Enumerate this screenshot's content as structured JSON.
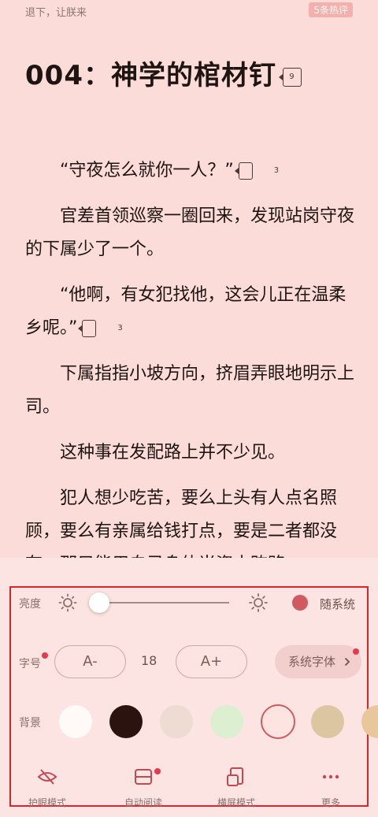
{
  "top": {
    "title": "退下，让朕来",
    "hot_comments": "5条热评"
  },
  "chapter": {
    "title": "004：神学的棺材钉",
    "comment_count": "9"
  },
  "paragraphs": [
    {
      "text": "“守夜怎么就你一人？”",
      "comments": "3"
    },
    {
      "text": "官差首领巡察一圈回来，发现站岗守夜的下属少了一个。"
    },
    {
      "text": "“他啊，有女犯找他，这会儿正在温柔乡呢。”",
      "comments": "3"
    },
    {
      "text": "下属指指小坡方向，挤眉弄眼地明示上司。"
    },
    {
      "text": "这种事在发配路上并不少见。"
    },
    {
      "text": "犯人想少吃苦，要么上头有人点名照顾，要么有亲属给钱打点，要是二者都没有，那只能用自己身体当资本贿赂"
    }
  ],
  "settings": {
    "brightness": {
      "label": "亮度",
      "level": 0.0,
      "system_label": "随系统"
    },
    "font_size": {
      "label": "字号",
      "decrease_label": "A-",
      "increase_label": "A+",
      "value": "18",
      "font_button_label": "系统字体"
    },
    "background": {
      "label": "背景",
      "colors": [
        "#fffaf8",
        "#2b1310",
        "#eedbd2",
        "#dcefd0",
        "#fde4e1",
        "#dcc6a2",
        "#e8c79c"
      ],
      "selected_index": 4
    }
  },
  "bottom_tabs": [
    {
      "label": "护眼模式",
      "icon": "eye-off-icon"
    },
    {
      "label": "自动阅读",
      "icon": "auto-read-icon"
    },
    {
      "label": "横屏模式",
      "icon": "rotate-screen-icon"
    },
    {
      "label": "更多",
      "icon": "more-icon"
    }
  ],
  "colors": {
    "page_background": "#fcdcd8",
    "panel_background": "#fbe4e1",
    "accent": "#cf5b61",
    "highlight_frame": "#d8262e",
    "notification_dot": "#e8394c"
  }
}
